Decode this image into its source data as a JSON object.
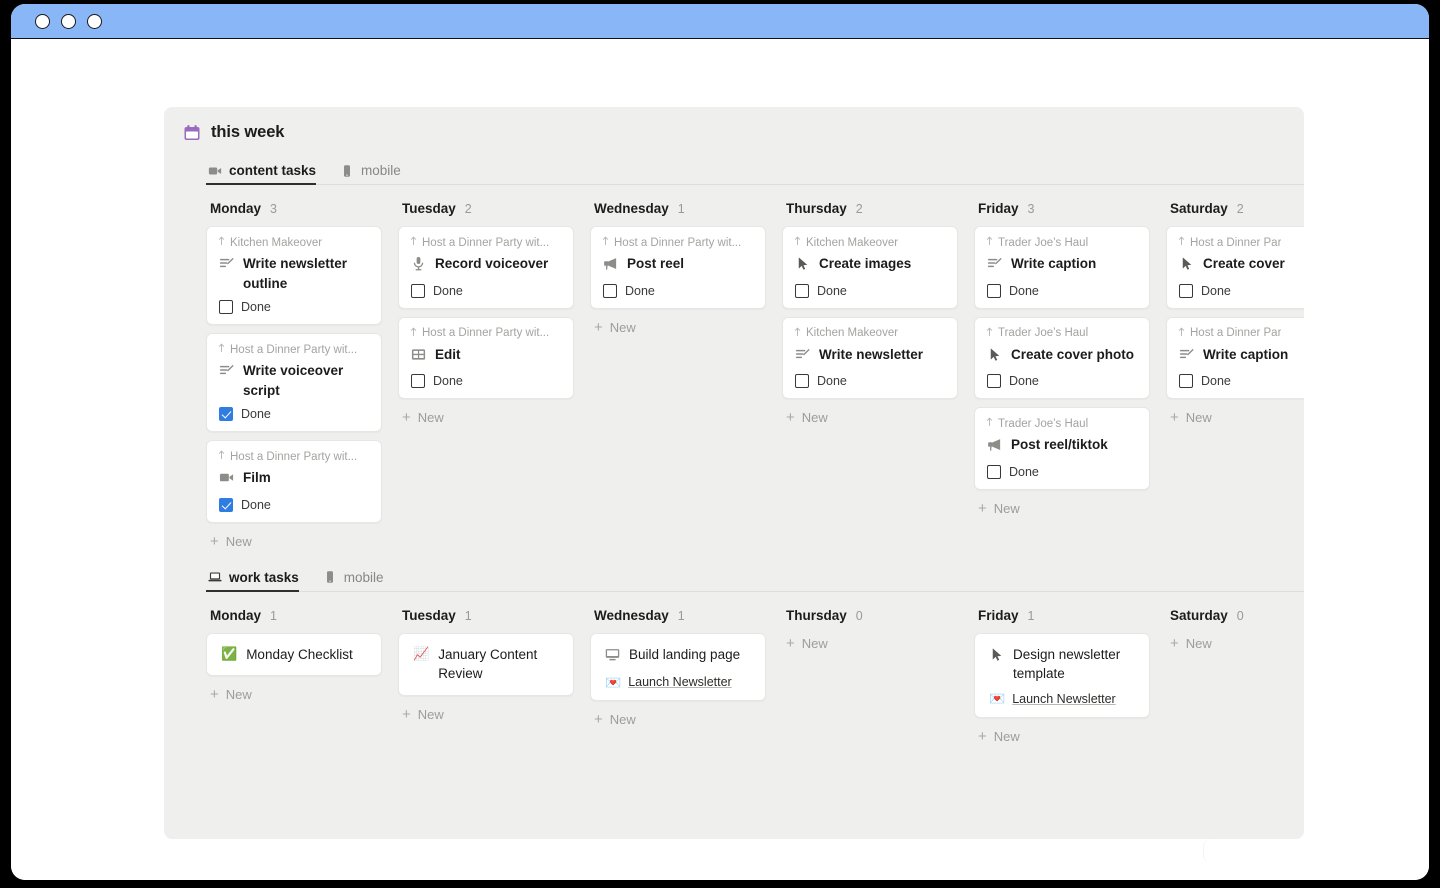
{
  "window": {
    "traffic_lights": [
      "close",
      "minimize",
      "zoom"
    ],
    "titlebar_color": "#88b6f7"
  },
  "board": {
    "icon": "calendar-icon",
    "title": "this week",
    "accent": "#9b6bbf"
  },
  "sections": [
    {
      "id": "content-tasks",
      "tabs": [
        {
          "label": "content tasks",
          "icon": "video-camera-icon",
          "active": true
        },
        {
          "label": "mobile",
          "icon": "phone-icon",
          "active": false
        }
      ],
      "columns": [
        {
          "day": "Monday",
          "count": "3",
          "new_label": "New",
          "cards": [
            {
              "relation": "Kitchen Makeover",
              "title": "Write newsletter outline",
              "icon": "write-icon",
              "check_label": "Done",
              "checked": false
            },
            {
              "relation": "Host a Dinner Party wit...",
              "title": "Write voiceover script",
              "icon": "write-icon",
              "check_label": "Done",
              "checked": true
            },
            {
              "relation": "Host a Dinner Party wit...",
              "title": "Film",
              "icon": "video-camera-icon",
              "check_label": "Done",
              "checked": true
            }
          ]
        },
        {
          "day": "Tuesday",
          "count": "2",
          "new_label": "New",
          "cards": [
            {
              "relation": "Host a Dinner Party wit...",
              "title": "Record voiceover",
              "icon": "microphone-icon",
              "check_label": "Done",
              "checked": false
            },
            {
              "relation": "Host a Dinner Party wit...",
              "title": "Edit",
              "icon": "grid-icon",
              "check_label": "Done",
              "checked": false
            }
          ]
        },
        {
          "day": "Wednesday",
          "count": "1",
          "new_label": "New",
          "cards": [
            {
              "relation": "Host a Dinner Party wit...",
              "title": "Post reel",
              "icon": "megaphone-icon",
              "check_label": "Done",
              "checked": false
            }
          ]
        },
        {
          "day": "Thursday",
          "count": "2",
          "new_label": "New",
          "cards": [
            {
              "relation": "Kitchen Makeover",
              "title": "Create images",
              "icon": "cursor-icon",
              "check_label": "Done",
              "checked": false
            },
            {
              "relation": "Kitchen Makeover",
              "title": "Write newsletter",
              "icon": "write-icon",
              "check_label": "Done",
              "checked": false
            }
          ]
        },
        {
          "day": "Friday",
          "count": "3",
          "new_label": "New",
          "cards": [
            {
              "relation": "Trader Joe’s Haul",
              "title": "Write caption",
              "icon": "write-icon",
              "check_label": "Done",
              "checked": false
            },
            {
              "relation": "Trader Joe’s Haul",
              "title": "Create cover photo",
              "icon": "cursor-icon",
              "check_label": "Done",
              "checked": false
            },
            {
              "relation": "Trader Joe’s Haul",
              "title": "Post reel/tiktok",
              "icon": "megaphone-icon",
              "check_label": "Done",
              "checked": false
            }
          ]
        },
        {
          "day": "Saturday",
          "count": "2",
          "new_label": "New",
          "cards": [
            {
              "relation": "Host a Dinner Par",
              "title": "Create cover",
              "icon": "cursor-icon",
              "check_label": "Done",
              "checked": false
            },
            {
              "relation": "Host a Dinner Par",
              "title": "Write caption",
              "icon": "write-icon",
              "check_label": "Done",
              "checked": false
            }
          ]
        }
      ]
    },
    {
      "id": "work-tasks",
      "tabs": [
        {
          "label": "work tasks",
          "icon": "laptop-icon",
          "active": true
        },
        {
          "label": "mobile",
          "icon": "phone-icon",
          "active": false
        }
      ],
      "columns": [
        {
          "day": "Monday",
          "count": "1",
          "new_label": "New",
          "cards": [
            {
              "title": "Monday Checklist",
              "emoji": "✅"
            }
          ]
        },
        {
          "day": "Tuesday",
          "count": "1",
          "new_label": "New",
          "cards": [
            {
              "title": "January Content Review",
              "emoji": "📈"
            }
          ]
        },
        {
          "day": "Wednesday",
          "count": "1",
          "new_label": "New",
          "cards": [
            {
              "title": "Build landing page",
              "icon": "monitor-icon",
              "link_label": "Launch Newsletter",
              "link_emoji": "💌"
            }
          ]
        },
        {
          "day": "Thursday",
          "count": "0",
          "new_label": "New",
          "cards": []
        },
        {
          "day": "Friday",
          "count": "1",
          "new_label": "New",
          "cards": [
            {
              "title": "Design newsletter template",
              "icon": "cursor-icon",
              "link_label": "Launch Newsletter",
              "link_emoji": "💌"
            }
          ]
        },
        {
          "day": "Saturday",
          "count": "0",
          "new_label": "New",
          "cards": []
        }
      ]
    }
  ]
}
